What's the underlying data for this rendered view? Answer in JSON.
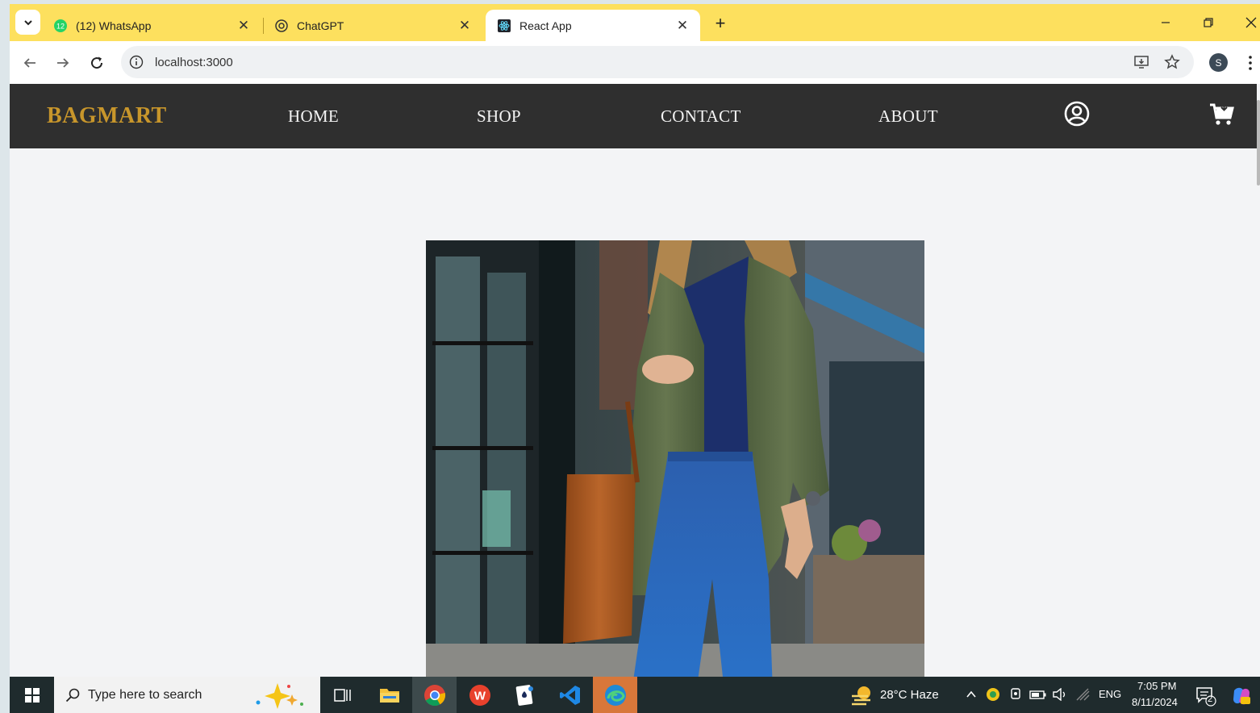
{
  "browser": {
    "tabs": [
      {
        "title": "(12) WhatsApp",
        "badge": "12"
      },
      {
        "title": "ChatGPT"
      },
      {
        "title": "React App"
      }
    ],
    "url": "localhost:3000",
    "profile_initial": "S"
  },
  "site": {
    "brand": "BAGMART",
    "nav": [
      "HOME",
      "SHOP",
      "CONTACT",
      "ABOUT"
    ],
    "colors": {
      "navbar": "#2f2f2f",
      "brand": "#c8962b",
      "page_bg": "#f3f4f6"
    }
  },
  "taskbar": {
    "search_placeholder": "Type here to search",
    "weather": "28°C  Haze",
    "language": "ENG",
    "time": "7:05 PM",
    "date": "8/11/2024",
    "notifications": "2"
  }
}
